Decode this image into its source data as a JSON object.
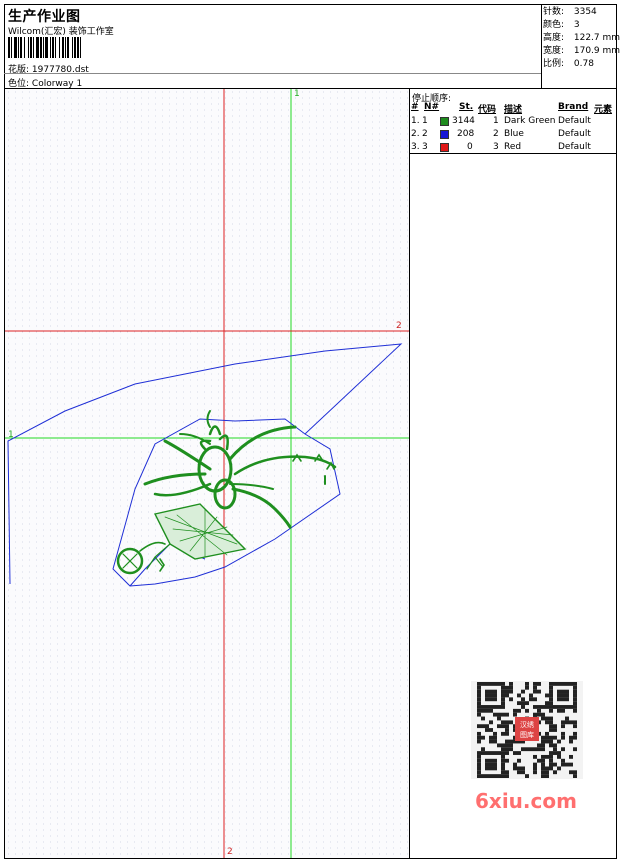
{
  "header": {
    "title": "生产作业图",
    "studio": "Wilcom(汇宏) 装饰工作室",
    "design_label": "花版:",
    "design_file": "1977780.dst",
    "color_label": "色位:",
    "colorway": "Colorway 1"
  },
  "stats": [
    {
      "label": "针数:",
      "value": "3354"
    },
    {
      "label": "颜色:",
      "value": "3"
    },
    {
      "label": "高度:",
      "value": "122.7 mm"
    },
    {
      "label": "宽度:",
      "value": "170.9 mm"
    },
    {
      "label": "比例:",
      "value": "0.78"
    }
  ],
  "canvas": {
    "axis_labels": {
      "green_top": "1",
      "green_left": "1",
      "red_right": "2",
      "red_bottom": "2"
    },
    "colors": {
      "green_axis": "#22d822",
      "red_axis": "#dd2222",
      "outline": "#1f2fd6",
      "stitch": "#1f8f1f"
    }
  },
  "stop_sequence": {
    "title": "停止顺序:",
    "headers": [
      "#",
      "N#",
      "St.",
      "代码",
      "描述",
      "Brand",
      "元素"
    ],
    "rows": [
      {
        "num": "1.",
        "n": "1",
        "color": "#1e8c1e",
        "st": "3144",
        "code": "1",
        "desc": "Dark Green",
        "brand": "Default"
      },
      {
        "num": "2.",
        "n": "2",
        "color": "#1717d6",
        "st": "208",
        "code": "2",
        "desc": "Blue",
        "brand": "Default"
      },
      {
        "num": "3.",
        "n": "3",
        "color": "#e01818",
        "st": "0",
        "code": "3",
        "desc": "Red",
        "brand": "Default"
      }
    ]
  },
  "watermark": {
    "text": "6xiu.com",
    "stamp": "汉绣图库"
  }
}
